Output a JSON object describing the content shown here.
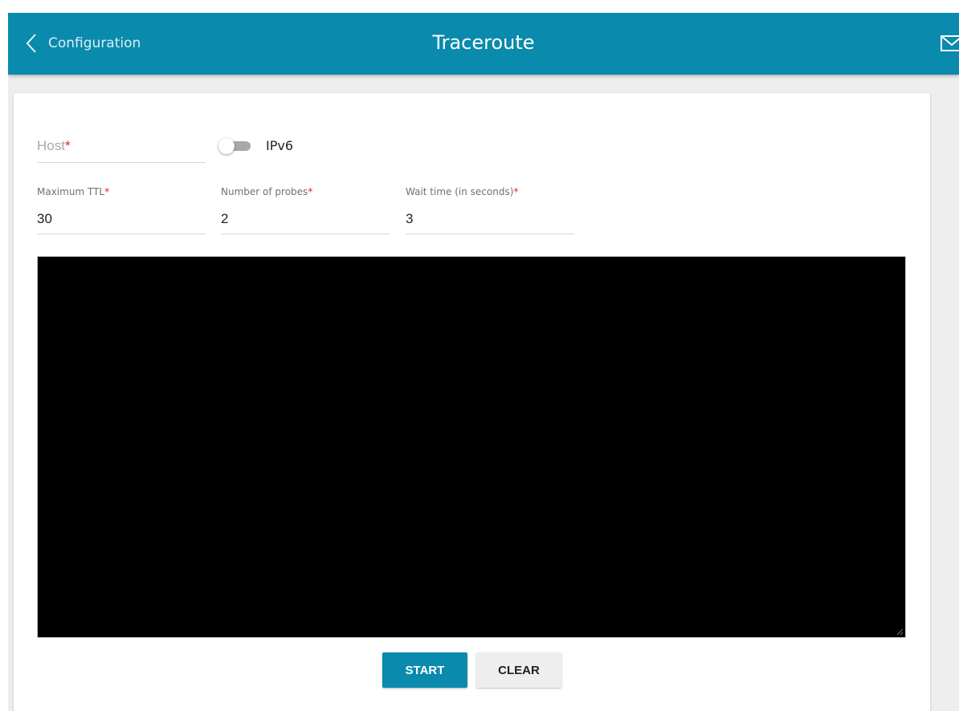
{
  "header": {
    "back_label": "Configuration",
    "title": "Traceroute",
    "back_icon": "chevron-left-icon",
    "mail_icon": "mail-icon",
    "color": "#0a8aac"
  },
  "form": {
    "host": {
      "label": "Host",
      "required_mark": "*",
      "value": ""
    },
    "ipv6": {
      "label": "IPv6",
      "enabled": false
    },
    "max_ttl": {
      "label": "Maximum TTL",
      "required_mark": "*",
      "value": "30"
    },
    "probes": {
      "label": "Number of probes",
      "required_mark": "*",
      "value": "2"
    },
    "wait_time": {
      "label": "Wait time (in seconds)",
      "required_mark": "*",
      "value": "3"
    }
  },
  "console": {
    "output": "",
    "background": "#000000"
  },
  "actions": {
    "start_label": "START",
    "clear_label": "CLEAR",
    "start_color": "#0a8aac"
  }
}
